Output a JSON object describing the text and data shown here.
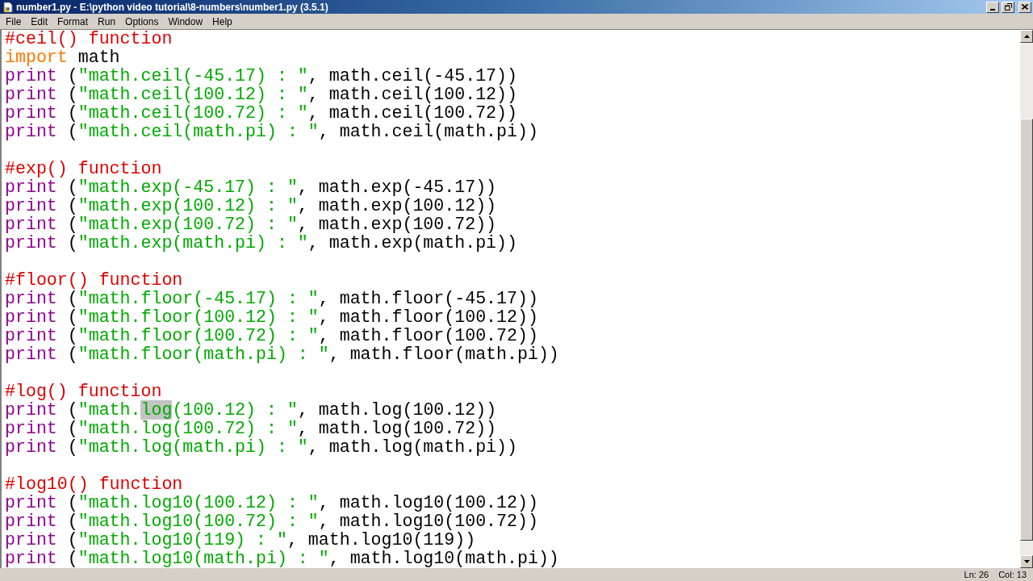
{
  "window": {
    "title": "number1.py - E:\\python video tutorial\\8-numbers\\number1.py (3.5.1)"
  },
  "menu": [
    "File",
    "Edit",
    "Format",
    "Run",
    "Options",
    "Window",
    "Help"
  ],
  "code_lines": [
    {
      "kind": "code",
      "segments": [
        {
          "kind": "comment",
          "text": "#ceil() function"
        }
      ]
    },
    {
      "kind": "code",
      "segments": [
        {
          "kind": "keyword",
          "text": "import"
        },
        {
          "kind": "plain",
          "text": " math"
        }
      ]
    },
    {
      "kind": "code",
      "segments": [
        {
          "kind": "builtin",
          "text": "print"
        },
        {
          "kind": "plain",
          "text": " ("
        },
        {
          "kind": "string",
          "text": "\"math.ceil(-45.17) : \""
        },
        {
          "kind": "plain",
          "text": ", math.ceil(-45.17))"
        }
      ]
    },
    {
      "kind": "code",
      "segments": [
        {
          "kind": "builtin",
          "text": "print"
        },
        {
          "kind": "plain",
          "text": " ("
        },
        {
          "kind": "string",
          "text": "\"math.ceil(100.12) : \""
        },
        {
          "kind": "plain",
          "text": ", math.ceil(100.12))"
        }
      ]
    },
    {
      "kind": "code",
      "segments": [
        {
          "kind": "builtin",
          "text": "print"
        },
        {
          "kind": "plain",
          "text": " ("
        },
        {
          "kind": "string",
          "text": "\"math.ceil(100.72) : \""
        },
        {
          "kind": "plain",
          "text": ", math.ceil(100.72))"
        }
      ]
    },
    {
      "kind": "code",
      "segments": [
        {
          "kind": "builtin",
          "text": "print"
        },
        {
          "kind": "plain",
          "text": " ("
        },
        {
          "kind": "string",
          "text": "\"math.ceil(math.pi) : \""
        },
        {
          "kind": "plain",
          "text": ", math.ceil(math.pi))"
        }
      ]
    },
    {
      "kind": "blank"
    },
    {
      "kind": "code",
      "segments": [
        {
          "kind": "comment",
          "text": "#exp() function"
        }
      ]
    },
    {
      "kind": "code",
      "segments": [
        {
          "kind": "builtin",
          "text": "print"
        },
        {
          "kind": "plain",
          "text": " ("
        },
        {
          "kind": "string",
          "text": "\"math.exp(-45.17) : \""
        },
        {
          "kind": "plain",
          "text": ", math.exp(-45.17))"
        }
      ]
    },
    {
      "kind": "code",
      "segments": [
        {
          "kind": "builtin",
          "text": "print"
        },
        {
          "kind": "plain",
          "text": " ("
        },
        {
          "kind": "string",
          "text": "\"math.exp(100.12) : \""
        },
        {
          "kind": "plain",
          "text": ", math.exp(100.12))"
        }
      ]
    },
    {
      "kind": "code",
      "segments": [
        {
          "kind": "builtin",
          "text": "print"
        },
        {
          "kind": "plain",
          "text": " ("
        },
        {
          "kind": "string",
          "text": "\"math.exp(100.72) : \""
        },
        {
          "kind": "plain",
          "text": ", math.exp(100.72))"
        }
      ]
    },
    {
      "kind": "code",
      "segments": [
        {
          "kind": "builtin",
          "text": "print"
        },
        {
          "kind": "plain",
          "text": " ("
        },
        {
          "kind": "string",
          "text": "\"math.exp(math.pi) : \""
        },
        {
          "kind": "plain",
          "text": ", math.exp(math.pi))"
        }
      ]
    },
    {
      "kind": "blank"
    },
    {
      "kind": "code",
      "segments": [
        {
          "kind": "comment",
          "text": "#floor() function"
        }
      ]
    },
    {
      "kind": "code",
      "segments": [
        {
          "kind": "builtin",
          "text": "print"
        },
        {
          "kind": "plain",
          "text": " ("
        },
        {
          "kind": "string",
          "text": "\"math.floor(-45.17) : \""
        },
        {
          "kind": "plain",
          "text": ", math.floor(-45.17))"
        }
      ]
    },
    {
      "kind": "code",
      "segments": [
        {
          "kind": "builtin",
          "text": "print"
        },
        {
          "kind": "plain",
          "text": " ("
        },
        {
          "kind": "string",
          "text": "\"math.floor(100.12) : \""
        },
        {
          "kind": "plain",
          "text": ", math.floor(100.12))"
        }
      ]
    },
    {
      "kind": "code",
      "segments": [
        {
          "kind": "builtin",
          "text": "print"
        },
        {
          "kind": "plain",
          "text": " ("
        },
        {
          "kind": "string",
          "text": "\"math.floor(100.72) : \""
        },
        {
          "kind": "plain",
          "text": ", math.floor(100.72))"
        }
      ]
    },
    {
      "kind": "code",
      "segments": [
        {
          "kind": "builtin",
          "text": "print"
        },
        {
          "kind": "plain",
          "text": " ("
        },
        {
          "kind": "string",
          "text": "\"math.floor(math.pi) : \""
        },
        {
          "kind": "plain",
          "text": ", math.floor(math.pi))"
        }
      ]
    },
    {
      "kind": "blank"
    },
    {
      "kind": "code",
      "segments": [
        {
          "kind": "comment",
          "text": "#log() function"
        }
      ]
    },
    {
      "kind": "code",
      "segments": [
        {
          "kind": "builtin",
          "text": "print"
        },
        {
          "kind": "plain",
          "text": " ("
        },
        {
          "kind": "string",
          "text": "\"math."
        },
        {
          "kind": "selected",
          "text": "log"
        },
        {
          "kind": "string",
          "text": "(100.12) : \""
        },
        {
          "kind": "plain",
          "text": ", math.log(100.12))"
        }
      ]
    },
    {
      "kind": "code",
      "segments": [
        {
          "kind": "builtin",
          "text": "print"
        },
        {
          "kind": "plain",
          "text": " ("
        },
        {
          "kind": "string",
          "text": "\"math.log(100.72) : \""
        },
        {
          "kind": "plain",
          "text": ", math.log(100.72))"
        }
      ]
    },
    {
      "kind": "code",
      "segments": [
        {
          "kind": "builtin",
          "text": "print"
        },
        {
          "kind": "plain",
          "text": " ("
        },
        {
          "kind": "string",
          "text": "\"math.log(math.pi) : \""
        },
        {
          "kind": "plain",
          "text": ", math.log(math.pi))"
        }
      ]
    },
    {
      "kind": "blank"
    },
    {
      "kind": "code",
      "segments": [
        {
          "kind": "comment",
          "text": "#log10() function"
        }
      ]
    },
    {
      "kind": "code",
      "segments": [
        {
          "kind": "builtin",
          "text": "print"
        },
        {
          "kind": "plain",
          "text": " ("
        },
        {
          "kind": "string",
          "text": "\"math.log10(100.12) : \""
        },
        {
          "kind": "plain",
          "text": ", math.log10(100.12))"
        }
      ]
    },
    {
      "kind": "code",
      "segments": [
        {
          "kind": "builtin",
          "text": "print"
        },
        {
          "kind": "plain",
          "text": " ("
        },
        {
          "kind": "string",
          "text": "\"math.log10(100.72) : \""
        },
        {
          "kind": "plain",
          "text": ", math.log10(100.72))"
        }
      ]
    },
    {
      "kind": "code",
      "segments": [
        {
          "kind": "builtin",
          "text": "print"
        },
        {
          "kind": "plain",
          "text": " ("
        },
        {
          "kind": "string",
          "text": "\"math.log10(119) : \""
        },
        {
          "kind": "plain",
          "text": ", math.log10(119))"
        }
      ]
    },
    {
      "kind": "code",
      "segments": [
        {
          "kind": "builtin",
          "text": "print"
        },
        {
          "kind": "plain",
          "text": " ("
        },
        {
          "kind": "string",
          "text": "\"math.log10(math.pi) : \""
        },
        {
          "kind": "plain",
          "text": ", math.log10(math.pi))"
        }
      ]
    }
  ],
  "status_bar": {
    "line": "Ln: 26",
    "column": "Col: 13"
  }
}
